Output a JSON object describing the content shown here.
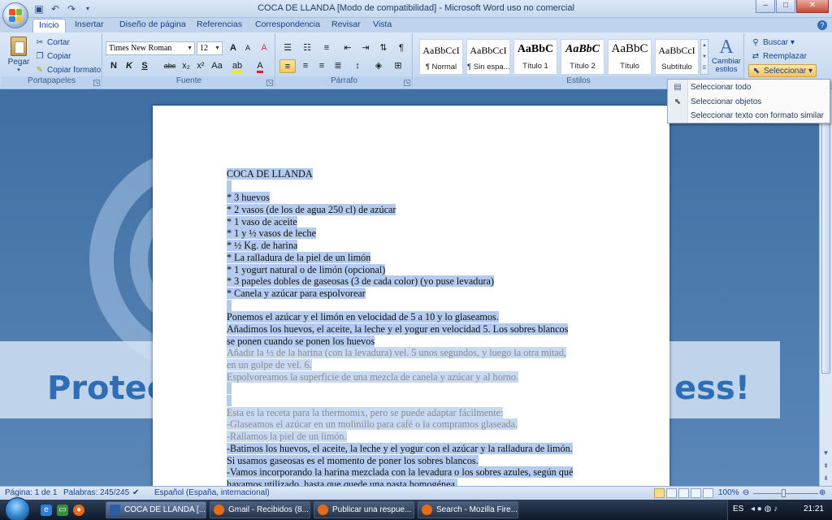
{
  "window": {
    "title": "COCA DE LLANDA [Modo de compatibilidad] - Microsoft Word uso no comercial",
    "controls": [
      "–",
      "□",
      "✕"
    ]
  },
  "quick_access": [
    "save-icon",
    "undo-icon",
    "redo-icon"
  ],
  "tabs": [
    "Inicio",
    "Insertar",
    "Diseño de página",
    "Referencias",
    "Correspondencia",
    "Revisar",
    "Vista"
  ],
  "ribbon": {
    "portapapeles": {
      "label": "Portapapeles",
      "paste": "Pegar",
      "cut": "Cortar",
      "copy": "Copiar",
      "format_painter": "Copiar formato"
    },
    "fuente": {
      "label": "Fuente",
      "font_name": "Times New Roman",
      "font_size": "12",
      "bold": "N",
      "italic": "K",
      "underline": "S",
      "strike": "abc",
      "subscript": "x₂",
      "superscript": "x²",
      "change_case": "Aa",
      "grow": "A",
      "shrink": "A",
      "clear": "A"
    },
    "parrafo": {
      "label": "Párrafo"
    },
    "estilos": {
      "label": "Estilos",
      "items": [
        {
          "sample": "AaBbCcI",
          "name": "¶ Normal"
        },
        {
          "sample": "AaBbCcI",
          "name": "¶ Sin espa..."
        },
        {
          "sample": "AaBbC",
          "name": "Título 1"
        },
        {
          "sample": "AaBbC",
          "name": "Título 2"
        },
        {
          "sample": "AaBbC",
          "name": "Título"
        },
        {
          "sample": "AaBbCcI",
          "name": "Subtítulo"
        }
      ],
      "change_styles": "Cambiar estilos"
    },
    "edicion": {
      "find": "Buscar",
      "replace": "Reemplazar",
      "select": "Seleccionar"
    }
  },
  "select_menu": [
    "Seleccionar todo",
    "Seleccionar objetos",
    "Seleccionar texto con formato similar"
  ],
  "document": {
    "lines": [
      "COCA DE LLANDA",
      "",
      "* 3 huevos",
      "* 2 vasos (de los de agua 250 cl) de azúcar",
      "* 1 vaso de aceite",
      "* 1 y ½ vasos de leche",
      "* ½ Kg. de harina",
      "* La ralladura de la piel de un limón",
      "* 1 yogurt natural o de limón (opcional)",
      "* 3 papeles dobles de gaseosas (3 de cada color) (yo puse levadura)",
      "* Canela y azúcar para espolvorear",
      "",
      "Ponemos el azúcar y el limón en velocidad de 5 a 10 y lo glaseamos.",
      "Añadimos los huevos, el aceite, la leche y el yogur en velocidad 5. Los sobres blancos",
      "se ponen cuando se ponen los huevos",
      "Añadir la ½ de la harina (con la levadura) vel. 5 unos segundos, y luego la otra mitad,",
      "en un golpe de vel. 6.",
      "Espolvoreamos la superficie de una mezcla de canela y azúcar y al horno.",
      "",
      "",
      "Esta es la receta para la thermomix, pero se puede adaptar fácilmente:",
      "-Glaseamos el azúcar en un molinillo para café o la compramos glaseada.",
      "-Rallamos la piel de un limón.",
      "-Batimos los huevos, el aceite, la leche y el yogur con el azúcar y la ralladura de limón.",
      "Si usamos gaseosas es el momento de poner los sobres blancos.",
      "-Vamos incorporando la harina mezclada con la levadura o los sobres azules, según qué",
      "hayamos utilizado, hasta que quede una pasta homogénea."
    ]
  },
  "wallpaper_text": {
    "left": "Protec",
    "right": "ess!"
  },
  "status": {
    "page": "Página: 1 de 1",
    "words": "Palabras: 245/245",
    "language": "Español (España, internacional)",
    "zoom": "100%"
  },
  "taskbar": {
    "tasks": [
      {
        "label": "COCA DE LLANDA [..."
      },
      {
        "label": "Gmail - Recibidos (8..."
      },
      {
        "label": "Publicar una respue..."
      },
      {
        "label": "Search - Mozilla Fire..."
      }
    ],
    "language": "ES",
    "clock": "21:21"
  }
}
